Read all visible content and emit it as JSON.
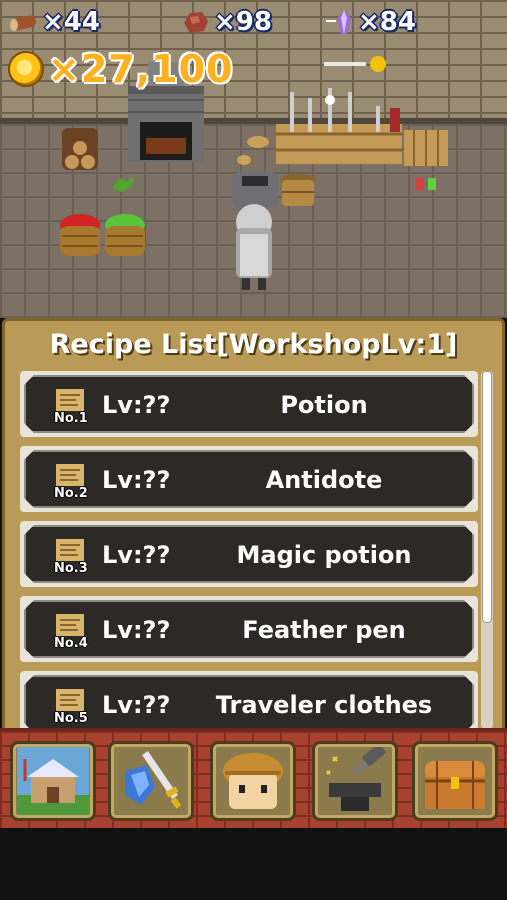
{
  "hud": {
    "wood": {
      "icon": "wood-log-icon",
      "prefix": "×",
      "count": "44"
    },
    "ore": {
      "icon": "ore-icon",
      "prefix": "×",
      "count": "98"
    },
    "crystal": {
      "icon": "crystal-icon",
      "prefix": "×",
      "count": "84"
    },
    "gold": {
      "icon": "gold-coin-icon",
      "prefix": "×",
      "count": "27,100"
    }
  },
  "panel": {
    "title": "Recipe List[WorkshopLv:1]",
    "recipes": [
      {
        "no": "No.1",
        "lv": "Lv:??",
        "name": "Potion"
      },
      {
        "no": "No.2",
        "lv": "Lv:??",
        "name": "Antidote"
      },
      {
        "no": "No.3",
        "lv": "Lv:??",
        "name": "Magic potion"
      },
      {
        "no": "No.4",
        "lv": "Lv:??",
        "name": "Feather pen"
      },
      {
        "no": "No.5",
        "lv": "Lv:??",
        "name": "Traveler clothes"
      }
    ]
  },
  "nav": [
    {
      "icon": "house-icon"
    },
    {
      "icon": "sword-shield-icon"
    },
    {
      "icon": "character-face-icon"
    },
    {
      "icon": "anvil-hammer-icon"
    },
    {
      "icon": "treasure-chest-icon"
    }
  ],
  "colors": {
    "gold_text": "#ffb01e",
    "panel": "#b99a57",
    "nav": "#a8412f"
  }
}
